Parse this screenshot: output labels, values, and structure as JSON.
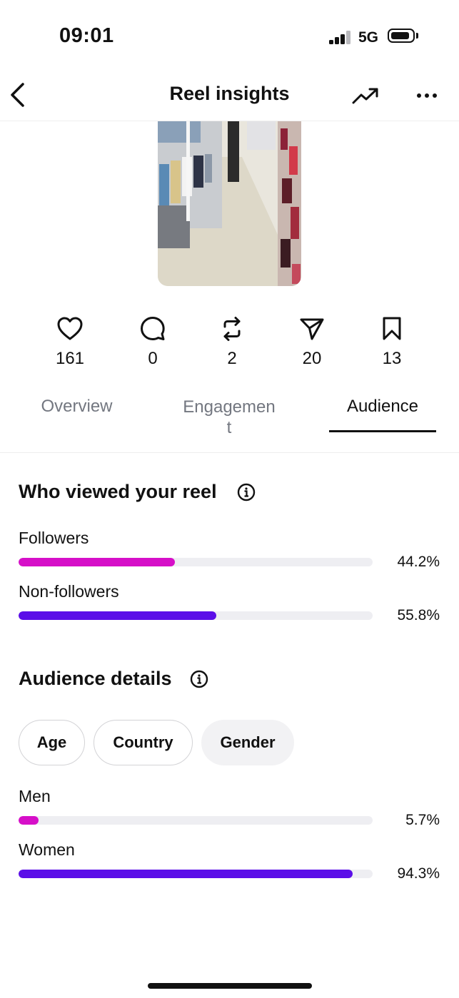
{
  "status_bar": {
    "time": "09:01",
    "network": "5G"
  },
  "header": {
    "title": "Reel insights"
  },
  "metrics": [
    {
      "icon": "heart-icon",
      "value": "161"
    },
    {
      "icon": "comment-icon",
      "value": "0"
    },
    {
      "icon": "repost-icon",
      "value": "2"
    },
    {
      "icon": "share-icon",
      "value": "20"
    },
    {
      "icon": "bookmark-icon",
      "value": "13"
    }
  ],
  "tabs": [
    {
      "label": "Overview",
      "selected": false
    },
    {
      "label": "Engagemen",
      "label_wrap": "t",
      "selected": false
    },
    {
      "label": "Audience",
      "selected": true
    }
  ],
  "viewers": {
    "title": "Who viewed your reel",
    "rows": [
      {
        "label": "Followers",
        "percent_text": "44.2%",
        "fraction": 0.442,
        "color": "#d60fc8"
      },
      {
        "label": "Non-followers",
        "percent_text": "55.8%",
        "fraction": 0.558,
        "color": "#5b0ee8"
      }
    ]
  },
  "audience": {
    "title": "Audience details",
    "chips": [
      {
        "label": "Age",
        "selected": false
      },
      {
        "label": "Country",
        "selected": false
      },
      {
        "label": "Gender",
        "selected": true
      }
    ],
    "rows": [
      {
        "label": "Men",
        "percent_text": "5.7%",
        "fraction": 0.057,
        "color": "#d60fc8"
      },
      {
        "label": "Women",
        "percent_text": "94.3%",
        "fraction": 0.943,
        "color": "#5b0ee8"
      }
    ]
  }
}
